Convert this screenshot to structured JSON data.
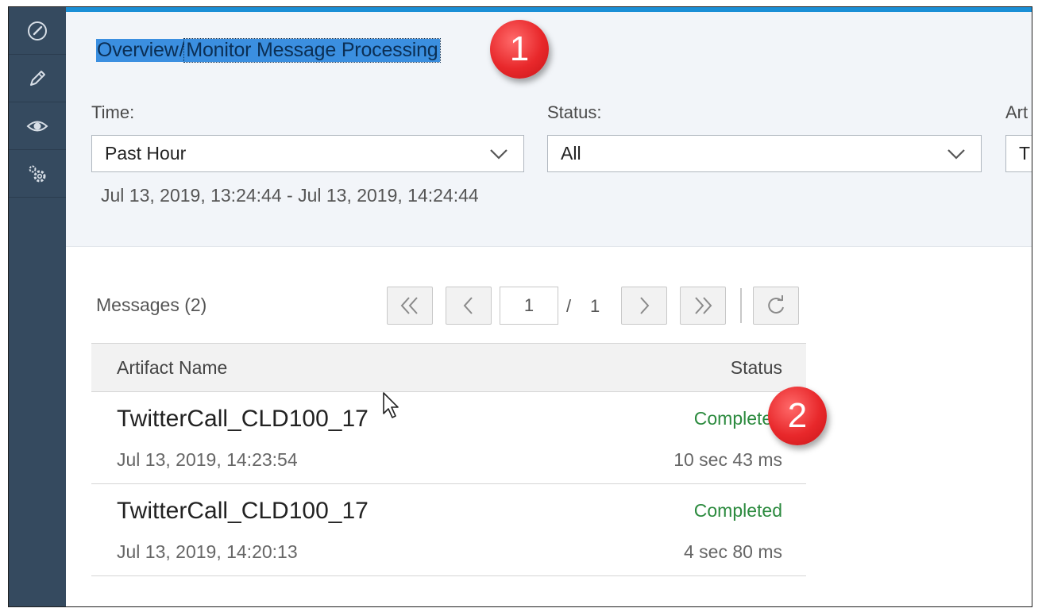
{
  "sidebar": {
    "items": [
      {
        "icon": "dashboard-icon"
      },
      {
        "icon": "pencil-icon"
      },
      {
        "icon": "eye-icon"
      },
      {
        "icon": "gears-icon"
      }
    ]
  },
  "breadcrumb": {
    "overview": "Overview",
    "separator": "/",
    "current": "Monitor Message Processing"
  },
  "markers": {
    "one": "1",
    "two": "2"
  },
  "filters": {
    "time_label": "Time:",
    "time_value": "Past Hour",
    "status_label": "Status:",
    "status_value": "All",
    "artifact_label": "Art",
    "artifact_value": "T",
    "time_range": "Jul 13, 2019, 13:24:44 - Jul 13, 2019, 14:24:44"
  },
  "messages": {
    "title": "Messages (2)",
    "page": "1",
    "page_separator": "/",
    "page_total": "1",
    "columns": {
      "name": "Artifact Name",
      "status": "Status"
    },
    "rows": [
      {
        "name": "TwitterCall_CLD100_17",
        "status": "Completed",
        "date": "Jul 13, 2019, 14:23:54",
        "duration": "10 sec 43 ms"
      },
      {
        "name": "TwitterCall_CLD100_17",
        "status": "Completed",
        "date": "Jul 13, 2019, 14:20:13",
        "duration": "4 sec 80 ms"
      }
    ]
  },
  "colors": {
    "sidebar": "#354a5f",
    "accent_bar": "#1a8fd6",
    "status_completed": "#2b8a3e",
    "marker": "#e8282b"
  }
}
